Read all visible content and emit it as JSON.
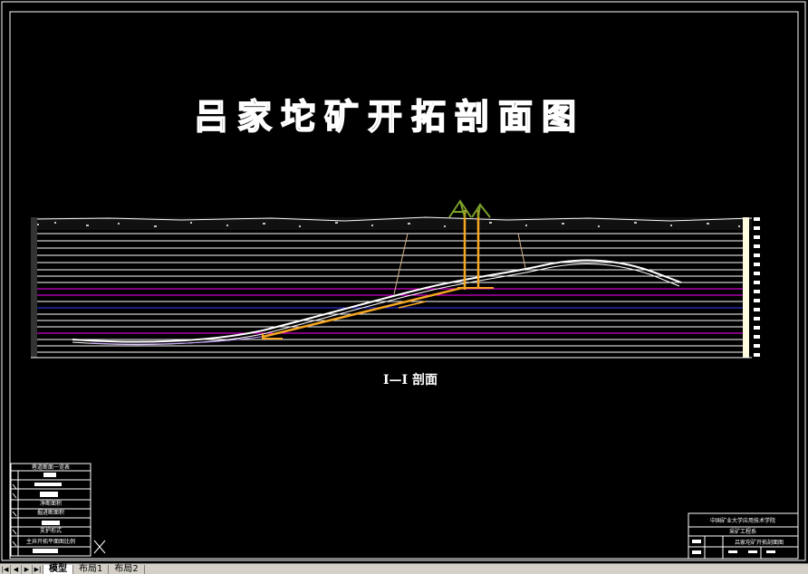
{
  "drawing": {
    "title": "吕家坨矿开拓剖面图",
    "section_caption": "Ⅰ—Ⅰ 剖面",
    "legend_table_header": "巷道断面一览表",
    "legend_rows": [
      "净断面积",
      "掘进断面积",
      "支护形式",
      "主井开拓平面图比例"
    ],
    "titleblock": {
      "school": "中国矿业大学应用技术学院",
      "department": "采矿工程系",
      "drawing_name": "吕家坨矿开拓剖面图"
    }
  },
  "tabs": {
    "nav": [
      "|◀",
      "◀",
      "▶",
      "▶|"
    ],
    "items": [
      {
        "label": "模型",
        "active": true
      },
      {
        "label": "布局1",
        "active": false
      },
      {
        "label": "布局2",
        "active": false
      }
    ]
  },
  "colors": {
    "background": "#000000",
    "frame": "#ffffff",
    "strata_white": "#ffffff",
    "strata_magenta": "#ff00ff",
    "strata_blue": "#3b3bff",
    "shaft_orange": "#f5a623",
    "headframe_green": "#7aa02a",
    "tab_bar": "#d4d0c8"
  }
}
